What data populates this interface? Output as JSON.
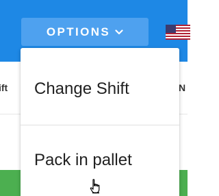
{
  "navbar": {
    "options_label": "OPTIONS",
    "chevron_icon": "chevron-down-icon",
    "flag_icon": "us-flag-icon",
    "accent_color": "#1e88e5",
    "button_color": "#4ea1ef"
  },
  "background_row": {
    "left_text": "ift",
    "right_text": "N"
  },
  "dropdown": {
    "items": [
      {
        "label": "Change Shift"
      },
      {
        "label": "Pack in pallet"
      }
    ]
  },
  "status_bar_color": "#4caf50",
  "cursor_icon": "hand-pointer-cursor-icon"
}
